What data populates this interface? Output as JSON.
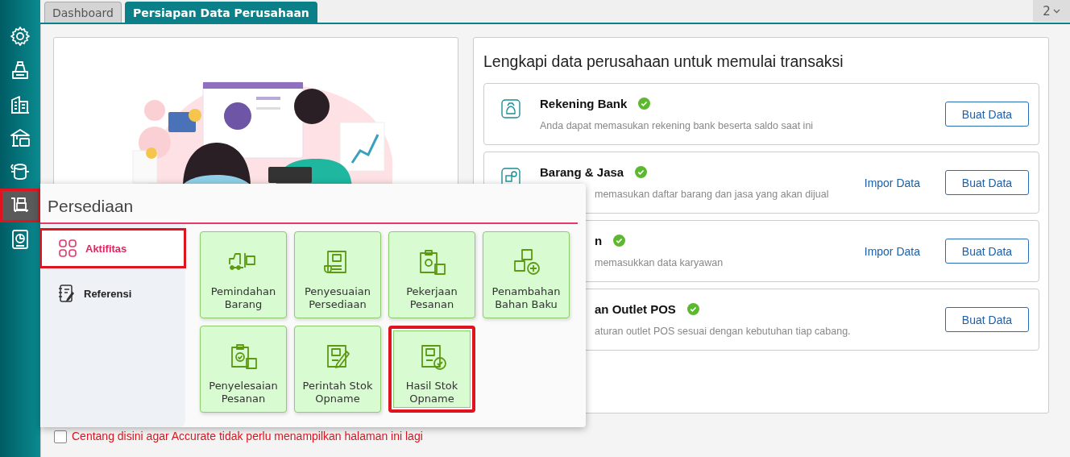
{
  "sidebar": {
    "items": [
      {
        "kind": "gear",
        "selected": false,
        "highlighted": false
      },
      {
        "kind": "register",
        "selected": false,
        "highlighted": false
      },
      {
        "kind": "building",
        "selected": false,
        "highlighted": false
      },
      {
        "kind": "bank",
        "selected": false,
        "highlighted": false
      },
      {
        "kind": "exchange",
        "selected": false,
        "highlighted": false
      },
      {
        "kind": "cart",
        "selected": true,
        "highlighted": true
      },
      {
        "kind": "report",
        "selected": false,
        "highlighted": false
      }
    ]
  },
  "tabs": [
    {
      "label": "Dashboard",
      "selected": false
    },
    {
      "label": "Persiapan Data Perusahaan",
      "selected": true
    }
  ],
  "tab_overflow": {
    "count": "2"
  },
  "setup": {
    "title": "Lengkapi data perusahaan untuk memulai transaksi",
    "cards": [
      {
        "kind": "bank",
        "title": "Rekening Bank",
        "done": true,
        "description": "Anda dapat memasukan rekening bank beserta saldo saat ini",
        "buttons": [
          {
            "label": "Buat Data",
            "kind": "outlined"
          }
        ]
      },
      {
        "kind": "goods",
        "title": "Barang & Jasa",
        "done": true,
        "description": "memasukan daftar barang dan jasa yang akan dijual",
        "buttons": [
          {
            "label": "Impor Data",
            "kind": "link"
          },
          {
            "label": "Buat Data",
            "kind": "outlined"
          }
        ]
      },
      {
        "kind": "covered",
        "title": "n",
        "done": true,
        "description": "memasukkan data karyawan",
        "buttons": [
          {
            "label": "Impor Data",
            "kind": "link"
          },
          {
            "label": "Buat Data",
            "kind": "outlined"
          }
        ]
      },
      {
        "kind": "covered",
        "title": "an Outlet POS",
        "done": true,
        "description": "aturan outlet POS sesuai dengan kebutuhan tiap cabang.",
        "buttons": [
          {
            "label": "Buat Data",
            "kind": "outlined"
          }
        ]
      }
    ]
  },
  "dont_show_again": {
    "label": "Centang disini agar Accurate tidak perlu menampilkan halaman ini lagi",
    "checked": false
  },
  "popup": {
    "title": "Persediaan",
    "tabs": [
      {
        "label": "Aktifitas",
        "kind": "grid",
        "selected": true,
        "highlighted": true
      },
      {
        "label": "Referensi",
        "kind": "notebook",
        "selected": false,
        "highlighted": false
      }
    ],
    "tiles": [
      {
        "label": "Pemindahan\nBarang",
        "kind": "forklift",
        "highlighted": false
      },
      {
        "label": "Penyesuaian\nPersediaan",
        "kind": "document",
        "highlighted": false
      },
      {
        "label": "Pekerjaan\nPesanan",
        "kind": "clipboard-gear",
        "highlighted": false
      },
      {
        "label": "Penambahan\nBahan Baku",
        "kind": "boxes-plus",
        "highlighted": false
      },
      {
        "label": "Penyelesaian\nPesanan",
        "kind": "clipboard-check",
        "highlighted": false
      },
      {
        "label": "Perintah Stok\nOpname",
        "kind": "doc-pencil",
        "highlighted": false
      },
      {
        "label": "Hasil Stok\nOpname",
        "kind": "doc-check",
        "highlighted": true
      }
    ]
  }
}
